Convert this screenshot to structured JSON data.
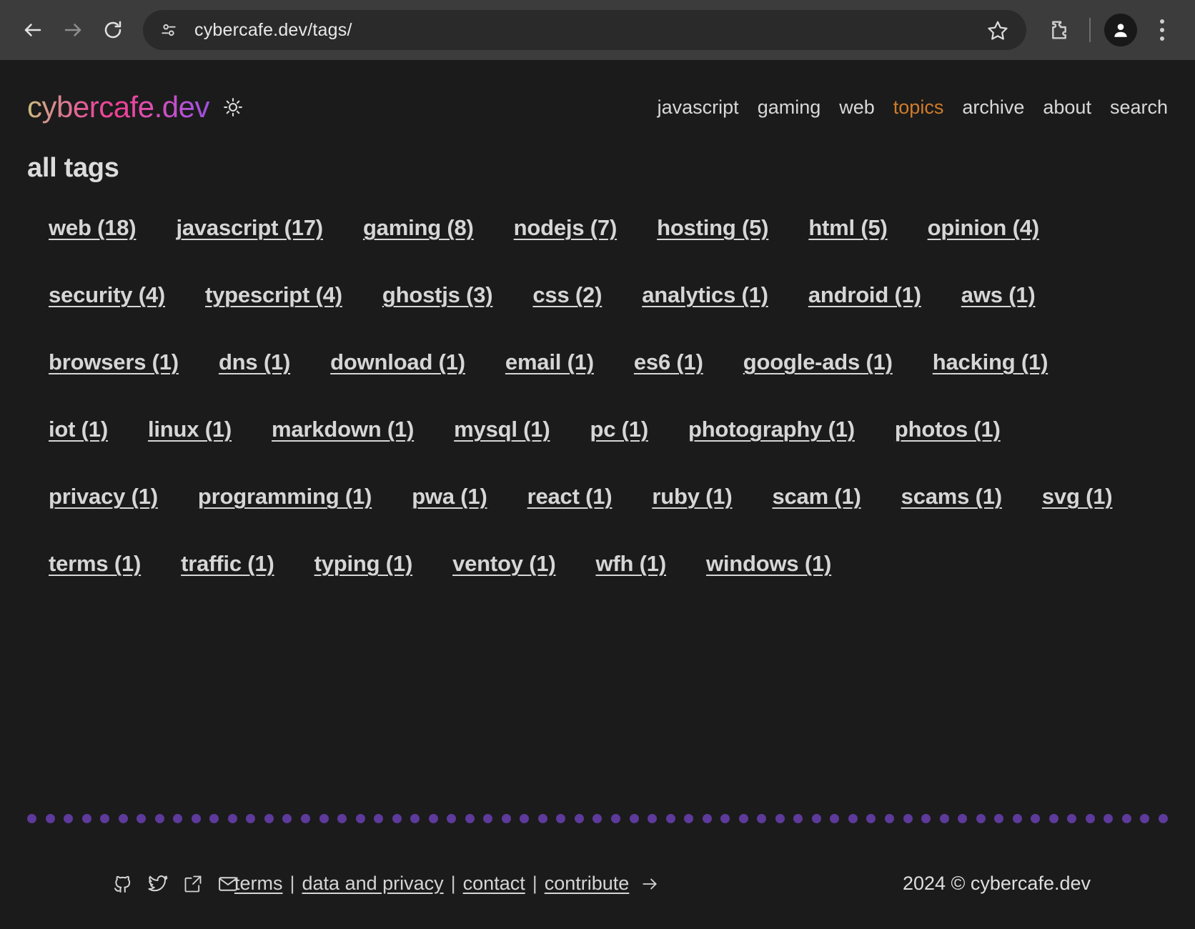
{
  "browser": {
    "back_label": "Back",
    "forward_label": "Forward",
    "reload_label": "Reload",
    "site_info_label": "View site information",
    "url": "cybercafe.dev/tags/",
    "bookmark_label": "Bookmark this tab",
    "extensions_label": "Extensions",
    "profile_label": "Profile",
    "menu_label": "Customize and control Chrome",
    "chrome_bg": "#3c3c3c",
    "omnibox_bg": "#2a2a2a"
  },
  "site": {
    "brand": "cybercafe.dev",
    "theme_toggle_label": "sun-icon",
    "accent_color": "#d07c2a",
    "background": "#1b1b1b",
    "nav": [
      {
        "label": "javascript",
        "active": false
      },
      {
        "label": "gaming",
        "active": false
      },
      {
        "label": "web",
        "active": false
      },
      {
        "label": "topics",
        "active": true
      },
      {
        "label": "archive",
        "active": false
      },
      {
        "label": "about",
        "active": false
      },
      {
        "label": "search",
        "active": false
      }
    ]
  },
  "main": {
    "title": "all tags",
    "tags": [
      {
        "name": "web",
        "count": 18,
        "label": "web (18)"
      },
      {
        "name": "javascript",
        "count": 17,
        "label": "javascript (17)"
      },
      {
        "name": "gaming",
        "count": 8,
        "label": "gaming (8)"
      },
      {
        "name": "nodejs",
        "count": 7,
        "label": "nodejs (7)"
      },
      {
        "name": "hosting",
        "count": 5,
        "label": "hosting (5)"
      },
      {
        "name": "html",
        "count": 5,
        "label": "html (5)"
      },
      {
        "name": "opinion",
        "count": 4,
        "label": "opinion (4)"
      },
      {
        "name": "security",
        "count": 4,
        "label": "security (4)"
      },
      {
        "name": "typescript",
        "count": 4,
        "label": "typescript (4)"
      },
      {
        "name": "ghostjs",
        "count": 3,
        "label": "ghostjs (3)"
      },
      {
        "name": "css",
        "count": 2,
        "label": "css (2)"
      },
      {
        "name": "analytics",
        "count": 1,
        "label": "analytics (1)"
      },
      {
        "name": "android",
        "count": 1,
        "label": "android (1)"
      },
      {
        "name": "aws",
        "count": 1,
        "label": "aws (1)"
      },
      {
        "name": "browsers",
        "count": 1,
        "label": "browsers (1)"
      },
      {
        "name": "dns",
        "count": 1,
        "label": "dns (1)"
      },
      {
        "name": "download",
        "count": 1,
        "label": "download (1)"
      },
      {
        "name": "email",
        "count": 1,
        "label": "email (1)"
      },
      {
        "name": "es6",
        "count": 1,
        "label": "es6 (1)"
      },
      {
        "name": "google-ads",
        "count": 1,
        "label": "google-ads (1)"
      },
      {
        "name": "hacking",
        "count": 1,
        "label": "hacking (1)"
      },
      {
        "name": "iot",
        "count": 1,
        "label": "iot (1)"
      },
      {
        "name": "linux",
        "count": 1,
        "label": "linux (1)"
      },
      {
        "name": "markdown",
        "count": 1,
        "label": "markdown (1)"
      },
      {
        "name": "mysql",
        "count": 1,
        "label": "mysql (1)"
      },
      {
        "name": "pc",
        "count": 1,
        "label": "pc (1)"
      },
      {
        "name": "photography",
        "count": 1,
        "label": "photography (1)"
      },
      {
        "name": "photos",
        "count": 1,
        "label": "photos (1)"
      },
      {
        "name": "privacy",
        "count": 1,
        "label": "privacy (1)"
      },
      {
        "name": "programming",
        "count": 1,
        "label": "programming (1)"
      },
      {
        "name": "pwa",
        "count": 1,
        "label": "pwa (1)"
      },
      {
        "name": "react",
        "count": 1,
        "label": "react (1)"
      },
      {
        "name": "ruby",
        "count": 1,
        "label": "ruby (1)"
      },
      {
        "name": "scam",
        "count": 1,
        "label": "scam (1)"
      },
      {
        "name": "scams",
        "count": 1,
        "label": "scams (1)"
      },
      {
        "name": "svg",
        "count": 1,
        "label": "svg (1)"
      },
      {
        "name": "terms",
        "count": 1,
        "label": "terms (1)"
      },
      {
        "name": "traffic",
        "count": 1,
        "label": "traffic (1)"
      },
      {
        "name": "typing",
        "count": 1,
        "label": "typing (1)"
      },
      {
        "name": "ventoy",
        "count": 1,
        "label": "ventoy (1)"
      },
      {
        "name": "wfh",
        "count": 1,
        "label": "wfh (1)"
      },
      {
        "name": "windows",
        "count": 1,
        "label": "windows (1)"
      }
    ]
  },
  "divider": {
    "dot_color": "#5d3a9b",
    "dot_count": 63
  },
  "footer": {
    "social": [
      {
        "icon": "github-icon",
        "label": "GitHub"
      },
      {
        "icon": "twitter-icon",
        "label": "Twitter"
      },
      {
        "icon": "external-link-icon",
        "label": "External link"
      },
      {
        "icon": "mail-icon",
        "label": "Email"
      }
    ],
    "links": [
      {
        "label": "terms"
      },
      {
        "label": "data and privacy"
      },
      {
        "label": "contact"
      },
      {
        "label": "contribute"
      }
    ],
    "separator": "|",
    "arrow_icon": "arrow-right-icon",
    "copyright": "2024 © cybercafe.dev"
  }
}
